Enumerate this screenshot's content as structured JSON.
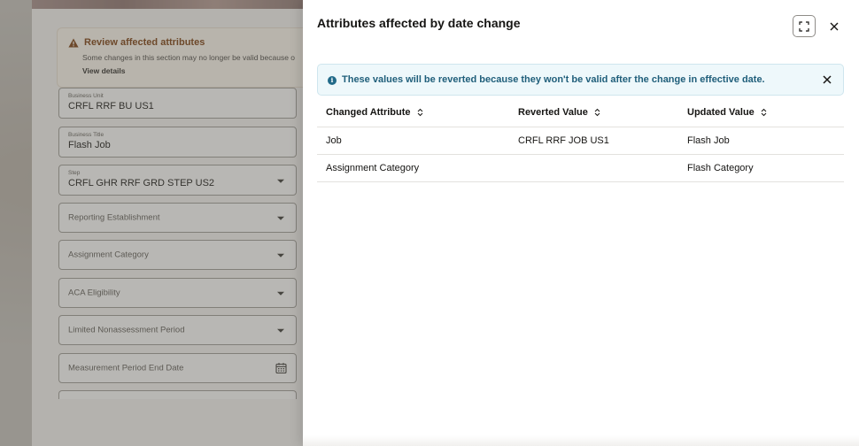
{
  "background_page": {
    "alert": {
      "title": "Review affected attributes",
      "message": "Some changes in this section may no longer be valid because o",
      "link": "View details"
    },
    "fields": [
      {
        "label": "Business Unit",
        "value": "CRFL RRF BU US1"
      },
      {
        "label": "Business Title",
        "value": "Flash Job"
      },
      {
        "label": "Step",
        "value": "CRFL GHR RRF GRD STEP US2"
      },
      {
        "label": "Reporting Establishment"
      },
      {
        "label": "Assignment Category"
      },
      {
        "label": "ACA Eligibility"
      },
      {
        "label": "Limited Nonassessment Period"
      },
      {
        "label": "Measurement Period End Date"
      }
    ]
  },
  "drawer": {
    "title": "Attributes affected by date change",
    "info_message": "These values will be reverted because they won't be valid after the change in effective date.",
    "table": {
      "columns": [
        "Changed Attribute",
        "Reverted Value",
        "Updated Value"
      ],
      "rows": [
        [
          "Job",
          "CRFL RRF JOB US1",
          "Flash Job"
        ],
        [
          "Assignment Category",
          "",
          "Flash Category"
        ]
      ]
    }
  },
  "colors": {
    "info_text": "#1f5e7a",
    "info_background": "#eef8fb",
    "warning_text": "#7a3d0e",
    "overlay": "rgba(90,87,82,0.42)"
  }
}
